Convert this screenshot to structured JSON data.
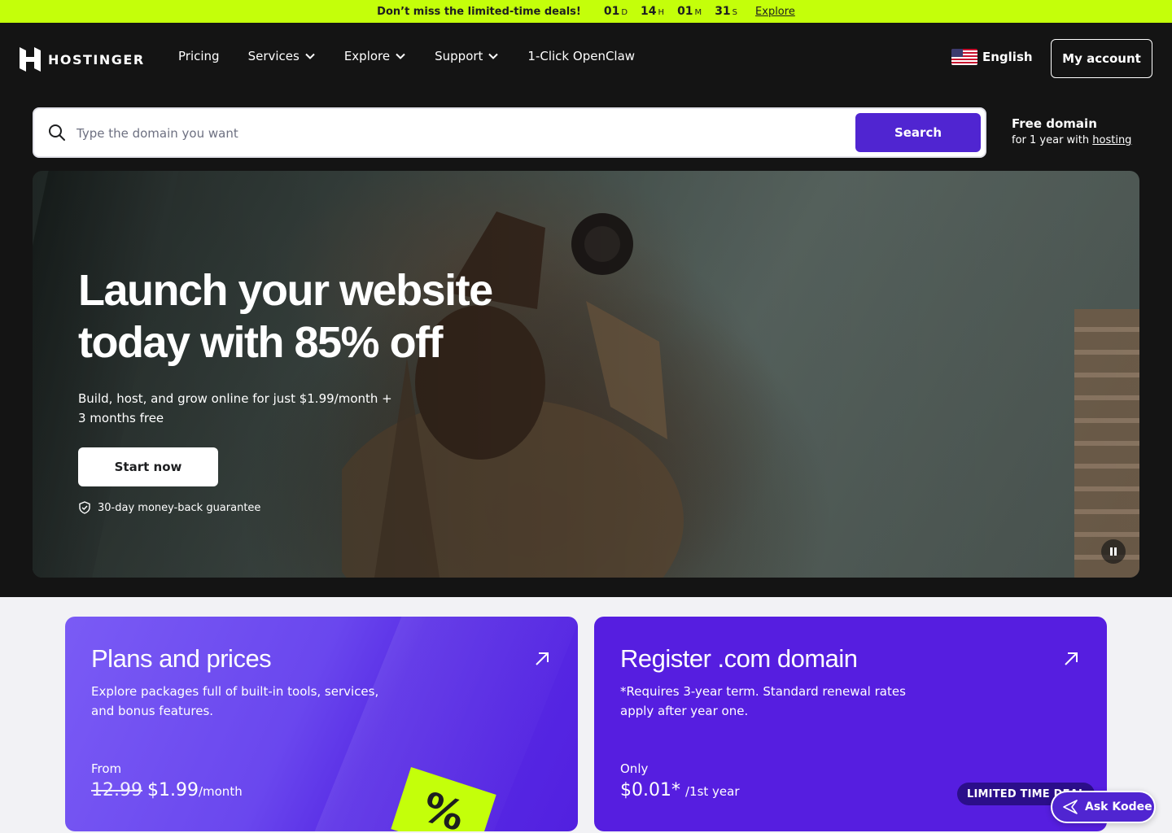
{
  "promo": {
    "message": "Don’t miss the limited-time deals!",
    "countdown": [
      {
        "num": "01",
        "unit": "D"
      },
      {
        "num": "14",
        "unit": "H"
      },
      {
        "num": "01",
        "unit": "M"
      },
      {
        "num": "31",
        "unit": "S"
      }
    ],
    "link_label": "Explore",
    "bg_color": "#c4ff0a"
  },
  "nav": {
    "logo_text": "HOSTINGER",
    "links": [
      {
        "label": "Pricing",
        "has_dropdown": false
      },
      {
        "label": "Services",
        "has_dropdown": true
      },
      {
        "label": "Explore",
        "has_dropdown": true
      },
      {
        "label": "Support",
        "has_dropdown": true
      },
      {
        "label": "1-Click OpenClaw",
        "has_dropdown": false
      }
    ],
    "language": "English",
    "account_label": "My account"
  },
  "search": {
    "placeholder": "Type the domain you want",
    "button_label": "Search",
    "free_domain_title": "Free domain",
    "free_domain_sub_prefix": "for 1 year with ",
    "free_domain_link": "hosting",
    "accent_color": "#5025d1"
  },
  "hero": {
    "title_line1": "Launch your website",
    "title_line2": "today with 85% off",
    "subtitle": "Build, host, and grow online for just $1.99/month + 3 months free",
    "cta_label": "Start now",
    "guarantee": "30-day money-back guarantee"
  },
  "cards": {
    "plans": {
      "title": "Plans and prices",
      "description": "Explore packages full of built-in tools, services, and bonus features.",
      "price_prefix": "From",
      "old_price": "12.99",
      "new_price": "$1.99",
      "period": "/month",
      "tag_symbol": "%"
    },
    "domain": {
      "title": "Register .com domain",
      "description": "*Requires 3-year term. Standard renewal rates apply after year one.",
      "price_prefix": "Only",
      "price": "$0.01*",
      "period": "/1st year",
      "badge": "LIMITED TIME DEAL"
    }
  },
  "assistant": {
    "label": "Ask Kodee"
  }
}
